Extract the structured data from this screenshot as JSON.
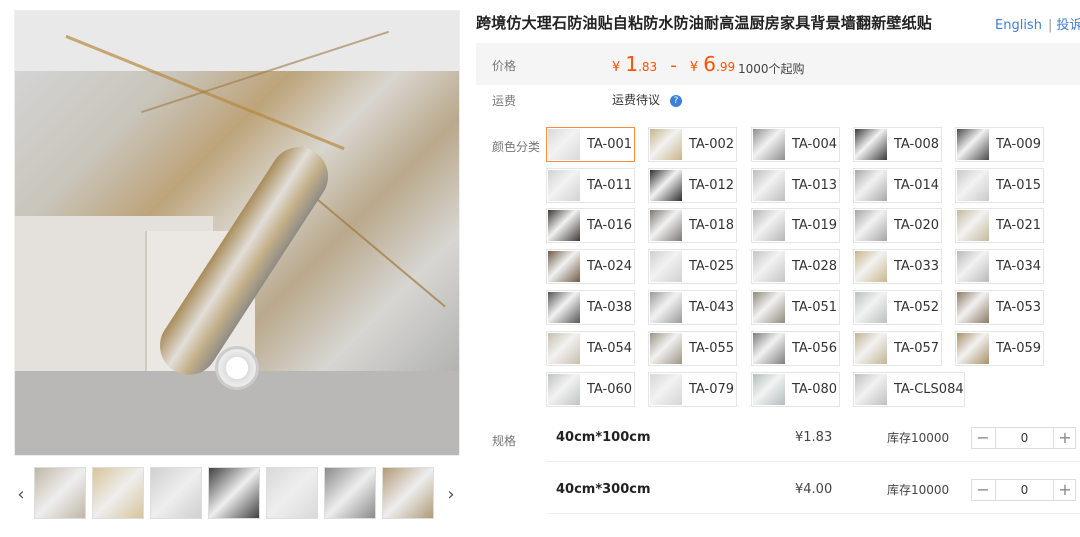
{
  "product": {
    "title": "跨境仿大理石防油贴自粘防水防油耐高温厨房家具背景墙翻新壁纸贴"
  },
  "header_links": {
    "english": "English",
    "complaint": "投诉"
  },
  "price": {
    "label": "价格",
    "low_currency": "¥",
    "low_int": "1",
    "low_dec": ".83",
    "separator": "-",
    "high_currency": "¥",
    "high_int": "6",
    "high_dec": ".99",
    "moq": "1000个起购"
  },
  "shipping": {
    "label": "运费",
    "value": "运费待议",
    "help_icon": "question-circle-icon"
  },
  "color": {
    "label": "颜色分类",
    "selected": "TA-001",
    "options": [
      {
        "name": "TA-001",
        "color": "#d9d9d9"
      },
      {
        "name": "TA-002",
        "color": "#c8b48a"
      },
      {
        "name": "TA-004",
        "color": "#8e8e8e"
      },
      {
        "name": "TA-008",
        "color": "#3a3a3a"
      },
      {
        "name": "TA-009",
        "color": "#4a4a4a"
      },
      {
        "name": "TA-011",
        "color": "#d2d2d2"
      },
      {
        "name": "TA-012",
        "color": "#2e2e2e"
      },
      {
        "name": "TA-013",
        "color": "#bdbdbd"
      },
      {
        "name": "TA-014",
        "color": "#a8a8a8"
      },
      {
        "name": "TA-015",
        "color": "#c9c9c9"
      },
      {
        "name": "TA-016",
        "color": "#3b3834"
      },
      {
        "name": "TA-018",
        "color": "#7b7773"
      },
      {
        "name": "TA-019",
        "color": "#b6b6b6"
      },
      {
        "name": "TA-020",
        "color": "#a5a5a5"
      },
      {
        "name": "TA-021",
        "color": "#c5b99e"
      },
      {
        "name": "TA-024",
        "color": "#6e5a47"
      },
      {
        "name": "TA-025",
        "color": "#cfcfcf"
      },
      {
        "name": "TA-028",
        "color": "#c4c4c4"
      },
      {
        "name": "TA-033",
        "color": "#c9b68c"
      },
      {
        "name": "TA-034",
        "color": "#b9b9b9"
      },
      {
        "name": "TA-038",
        "color": "#555555"
      },
      {
        "name": "TA-043",
        "color": "#9a9a9a"
      },
      {
        "name": "TA-051",
        "color": "#8f8a7a"
      },
      {
        "name": "TA-052",
        "color": "#b8c2bd"
      },
      {
        "name": "TA-053",
        "color": "#8c7a62"
      },
      {
        "name": "TA-054",
        "color": "#c6bfae"
      },
      {
        "name": "TA-055",
        "color": "#9d9486"
      },
      {
        "name": "TA-056",
        "color": "#7d7d7d"
      },
      {
        "name": "TA-057",
        "color": "#c2b596"
      },
      {
        "name": "TA-059",
        "color": "#a89068"
      },
      {
        "name": "TA-060",
        "color": "#c0c4c4"
      },
      {
        "name": "TA-079",
        "color": "#d6d6d6"
      },
      {
        "name": "TA-080",
        "color": "#b3bdbd"
      },
      {
        "name": "TA-CLS084",
        "color": "#bfbfbf"
      }
    ]
  },
  "spec": {
    "label": "规格",
    "rows": [
      {
        "name": "40cm*100cm",
        "price": "¥1.83",
        "stock": "库存10000",
        "qty": "0"
      },
      {
        "name": "40cm*300cm",
        "price": "¥4.00",
        "stock": "库存10000",
        "qty": "0"
      }
    ]
  },
  "stepper": {
    "minus": "−",
    "plus": "+"
  },
  "gallery": {
    "prev": "‹",
    "next": "›",
    "thumbs": [
      "#bfb7a5",
      "#d8c49a",
      "#cfcfcf",
      "#404040",
      "#d9d9d9",
      "#8a8a8a",
      "#b09a78"
    ]
  }
}
